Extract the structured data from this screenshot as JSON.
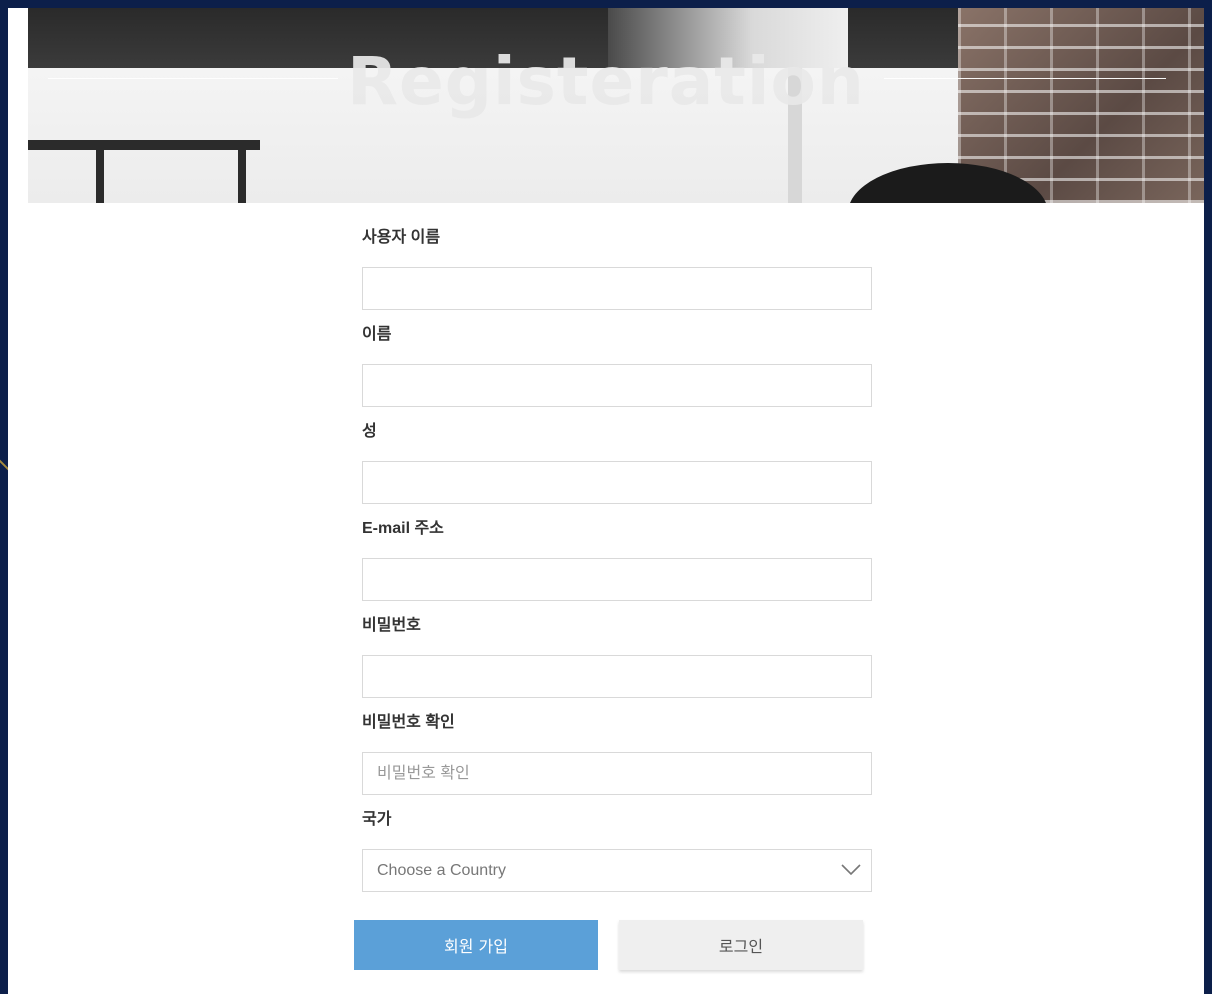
{
  "hero": {
    "title": "Registeration"
  },
  "form": {
    "username": {
      "label": "사용자 이름",
      "value": "",
      "placeholder": ""
    },
    "first_name": {
      "label": "이름",
      "value": "",
      "placeholder": ""
    },
    "last_name": {
      "label": "성",
      "value": "",
      "placeholder": ""
    },
    "email": {
      "label": "E-mail 주소",
      "value": "",
      "placeholder": ""
    },
    "password": {
      "label": "비밀번호",
      "value": "",
      "placeholder": ""
    },
    "password_confirm": {
      "label": "비밀번호 확인",
      "value": "",
      "placeholder": "비밀번호 확인"
    },
    "country": {
      "label": "국가",
      "selected": "Choose a Country",
      "icon": "chevron-down-icon"
    }
  },
  "buttons": {
    "signup_label": "회원 가입",
    "login_label": "로그인"
  },
  "colors": {
    "page_background": "#0c1f4a",
    "primary_button": "#5ba0d8",
    "secondary_button": "#efefef"
  }
}
